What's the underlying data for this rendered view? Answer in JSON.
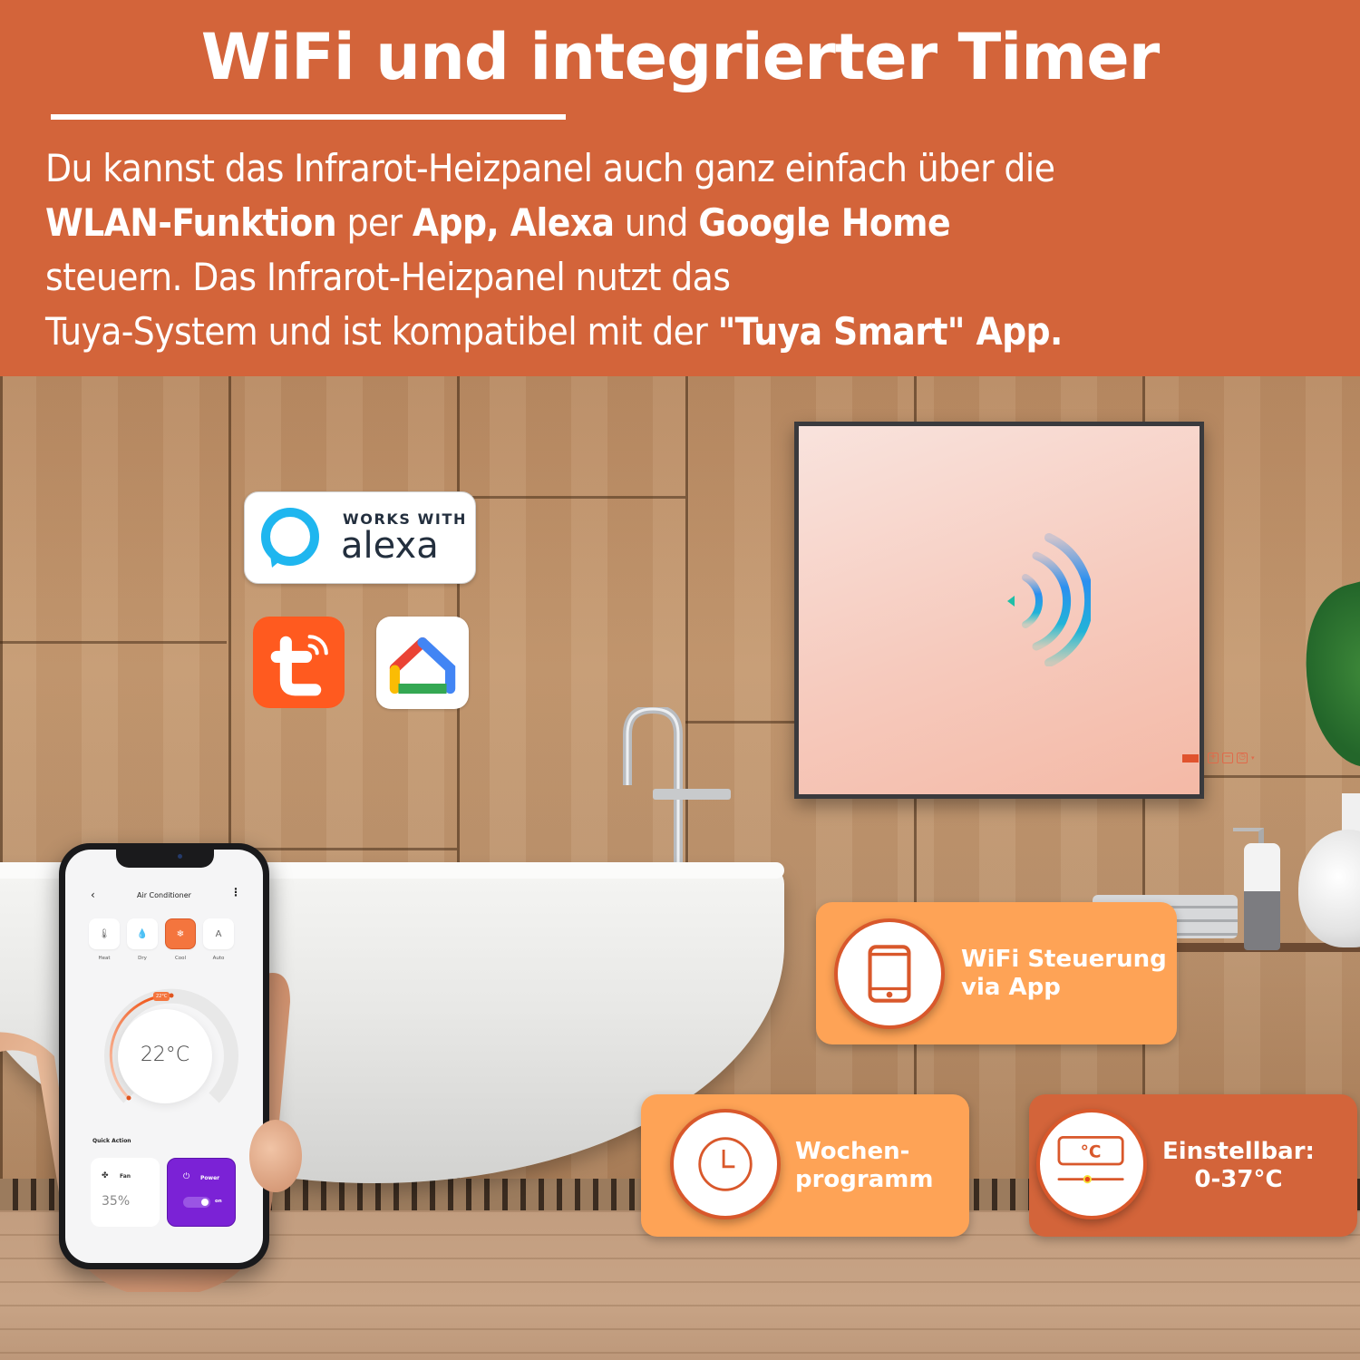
{
  "header": {
    "title": "WiFi und integrierter Timer",
    "paragraph": {
      "line1": "Du kannst das Infrarot-Heizpanel auch ganz einfach über die",
      "line2_bold1": "WLAN-Funktion",
      "line2_text1": " per ",
      "line2_bold2": "App, Alexa",
      "line2_text2": " und ",
      "line2_bold3": "Google Home",
      "line3": "steuern. Das Infrarot-Heizpanel nutzt das",
      "line4_text": "Tuya-System und ist kompatibel mit der ",
      "line4_bold": "\"Tuya Smart\" App."
    }
  },
  "badges": {
    "alexa_top": "WORKS WITH",
    "alexa_word": "alexa",
    "tuya": "tuya-smart-app-icon",
    "google_home": "google-home-app-icon"
  },
  "heater": {
    "wifi_icon": "wifi-signal-icon",
    "controls": [
      "display",
      "plus",
      "minus",
      "timer"
    ],
    "plus_glyph": "+",
    "minus_glyph": "−",
    "timer_glyph": "◷",
    "caret_glyph": "▾"
  },
  "phone_app": {
    "back_glyph": "‹",
    "title": "Air Conditioner",
    "more_glyph": "⋮",
    "modes": [
      {
        "label": "Heat",
        "glyph": "🌡",
        "active": false
      },
      {
        "label": "Dry",
        "glyph": "💧",
        "active": false
      },
      {
        "label": "Cool",
        "glyph": "❄",
        "active": true
      },
      {
        "label": "Auto",
        "glyph": "A",
        "active": false
      }
    ],
    "setpoint_pill": "22°C",
    "temperature": "22°C",
    "quick_action_title": "Quick Action",
    "fan": {
      "label": "Fan",
      "value": "35%",
      "glyph": "✤"
    },
    "power": {
      "label": "Power",
      "glyph": "⏻",
      "toggle_label": "on",
      "on": true
    }
  },
  "features": [
    {
      "icon": "smartphone-icon",
      "line1": "WiFi Steuerung",
      "line2": "via App"
    },
    {
      "icon": "clock-icon",
      "line1": "Wochen-",
      "line2": "programm"
    },
    {
      "icon": "thermostat-icon",
      "icon_text": "°C",
      "line1": "Einstellbar:",
      "line2": "0-37°C"
    }
  ],
  "colors": {
    "brand_orange": "#d3643a",
    "card_light": "#fea356",
    "icon_stroke": "#d9582b",
    "app_accent": "#f4753e",
    "app_power": "#7b22d6"
  }
}
